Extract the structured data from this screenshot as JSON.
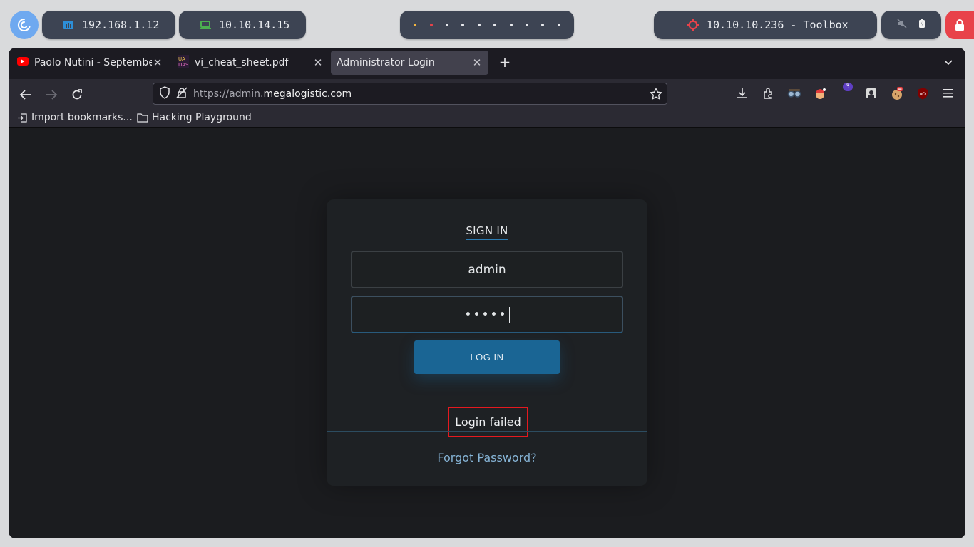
{
  "topbar": {
    "ip_local": "192.168.1.12",
    "ip_vpn": "10.10.14.15",
    "target": "10.10.10.236 - Toolbox",
    "workspace_colors": [
      "#f4b63f",
      "#e8424a",
      "#e8eaee",
      "#e8eaee",
      "#e8eaee",
      "#e8eaee",
      "#e8eaee",
      "#e8eaee",
      "#e8eaee",
      "#e8eaee"
    ],
    "colors": {
      "accent": "#6fa9f0",
      "lock": "#e8424a",
      "vpn_icon": "#4caf50",
      "local_icon": "#2d8fd8",
      "target_icon": "#e8424a"
    }
  },
  "browser": {
    "tabs": [
      {
        "title": "Paolo Nutini - September",
        "icon": "youtube-icon"
      },
      {
        "title": "vi_cheat_sheet.pdf",
        "icon": "pdf-icon"
      },
      {
        "title": "Administrator Login",
        "icon": ""
      }
    ],
    "url_prefix": "https://admin.",
    "url_host": "megalogistic.com",
    "extension_badge": "3",
    "bookmarks": [
      {
        "label": "Import bookmarks...",
        "icon": "import-icon"
      },
      {
        "label": "Hacking Playground",
        "icon": "folder-icon"
      }
    ]
  },
  "login": {
    "heading": "SIGN IN",
    "username": "admin",
    "password_mask": "•••••",
    "button": "LOG IN",
    "message": "Login failed",
    "forgot": "Forgot Password?"
  }
}
